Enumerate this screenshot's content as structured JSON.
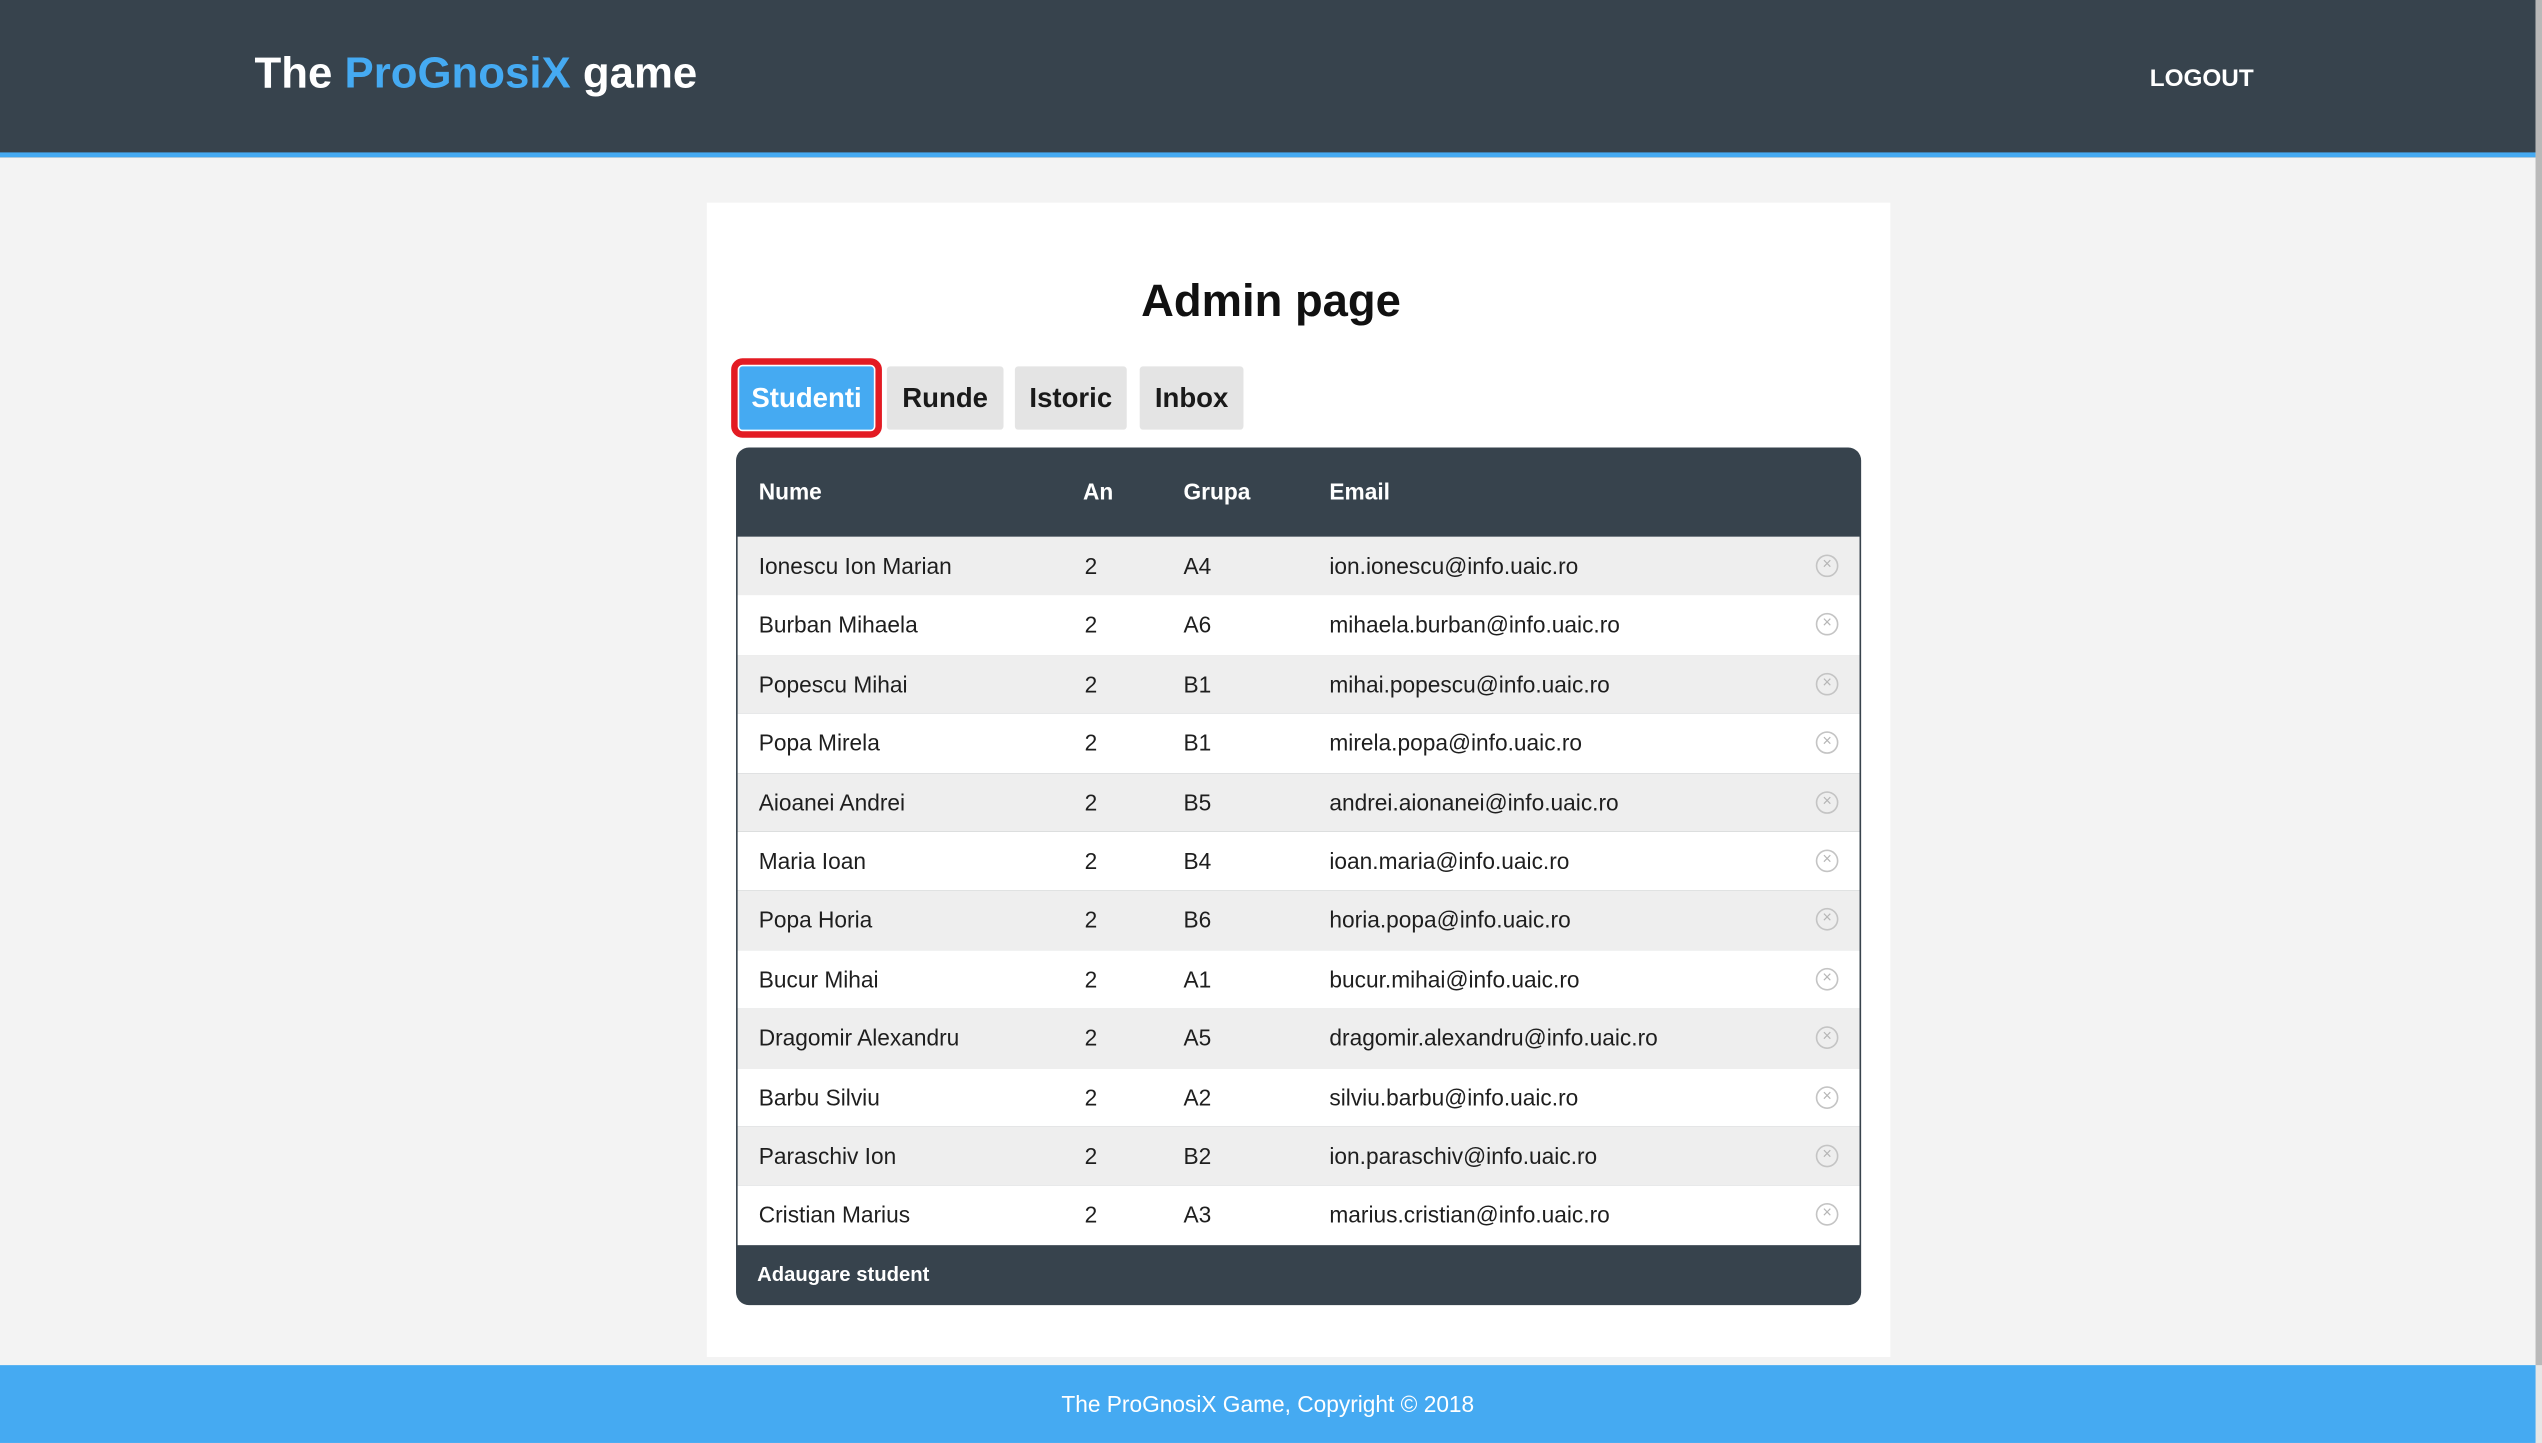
{
  "header": {
    "brand_prefix": "The ",
    "brand_accent": "ProGnosiX",
    "brand_suffix": " game",
    "logout_label": "LOGOUT"
  },
  "main": {
    "title": "Admin page",
    "tabs": [
      {
        "label": "Studenti",
        "active": true
      },
      {
        "label": "Runde",
        "active": false
      },
      {
        "label": "Istoric",
        "active": false
      },
      {
        "label": "Inbox",
        "active": false
      }
    ]
  },
  "table": {
    "columns": [
      "Nume",
      "An",
      "Grupa",
      "Email"
    ],
    "rows": [
      {
        "nume": "Ionescu Ion Marian",
        "an": "2",
        "grupa": "A4",
        "email": "ion.ionescu@info.uaic.ro"
      },
      {
        "nume": "Burban Mihaela",
        "an": "2",
        "grupa": "A6",
        "email": "mihaela.burban@info.uaic.ro"
      },
      {
        "nume": "Popescu Mihai",
        "an": "2",
        "grupa": "B1",
        "email": "mihai.popescu@info.uaic.ro"
      },
      {
        "nume": "Popa Mirela",
        "an": "2",
        "grupa": "B1",
        "email": "mirela.popa@info.uaic.ro"
      },
      {
        "nume": "Aioanei Andrei",
        "an": "2",
        "grupa": "B5",
        "email": "andrei.aionanei@info.uaic.ro"
      },
      {
        "nume": "Maria Ioan",
        "an": "2",
        "grupa": "B4",
        "email": "ioan.maria@info.uaic.ro"
      },
      {
        "nume": "Popa Horia",
        "an": "2",
        "grupa": "B6",
        "email": "horia.popa@info.uaic.ro"
      },
      {
        "nume": "Bucur Mihai",
        "an": "2",
        "grupa": "A1",
        "email": "bucur.mihai@info.uaic.ro"
      },
      {
        "nume": "Dragomir Alexandru",
        "an": "2",
        "grupa": "A5",
        "email": "dragomir.alexandru@info.uaic.ro"
      },
      {
        "nume": "Barbu Silviu",
        "an": "2",
        "grupa": "A2",
        "email": "silviu.barbu@info.uaic.ro"
      },
      {
        "nume": "Paraschiv Ion",
        "an": "2",
        "grupa": "B2",
        "email": "ion.paraschiv@info.uaic.ro"
      },
      {
        "nume": "Cristian Marius",
        "an": "2",
        "grupa": "A3",
        "email": "marius.cristian@info.uaic.ro"
      }
    ],
    "delete_icon": "close-circle-icon",
    "add_label": "Adaugare student"
  },
  "footer": {
    "text": "The ProGnosiX Game, Copyright © 2018"
  },
  "colors": {
    "header_bg": "#37434d",
    "accent": "#45aaf2",
    "active_tab_outline": "#e31b23",
    "page_bg": "#f3f3f3"
  }
}
